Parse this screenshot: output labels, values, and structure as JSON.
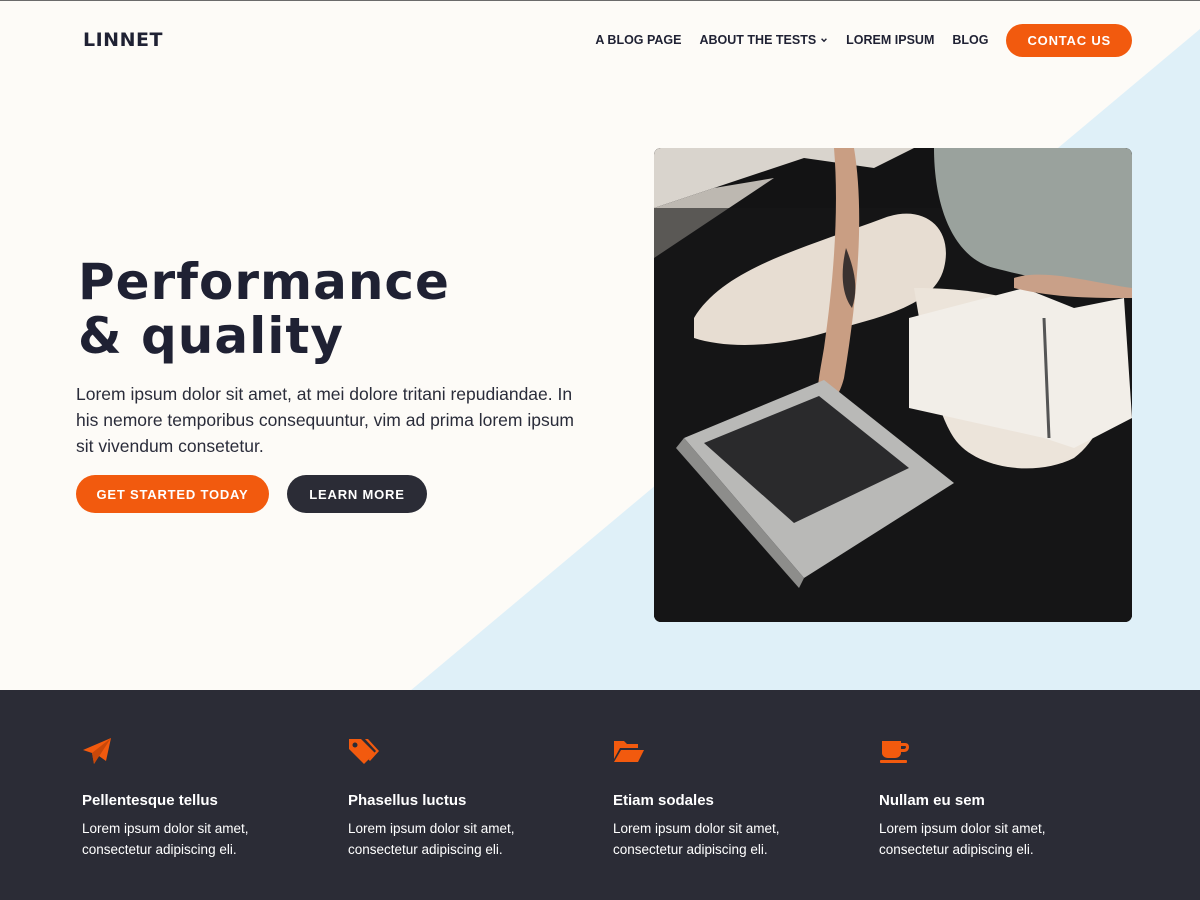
{
  "colors": {
    "accent": "#f25a0e",
    "dark": "#2b2c36",
    "navy_text": "#1f2133",
    "light_bg": "#fdfbf7",
    "light_blue": "#dff0f8"
  },
  "header": {
    "logo": "LINNET",
    "nav": [
      {
        "label": "A BLOG PAGE"
      },
      {
        "label": "ABOUT THE TESTS",
        "has_dropdown": true,
        "icon": "chevron-down-icon"
      },
      {
        "label": "LOREM IPSUM"
      },
      {
        "label": "BLOG"
      }
    ],
    "cta_label": "CONTAC US"
  },
  "hero": {
    "title_line1": "Performance",
    "title_line2": "& quality",
    "text": "Lorem ipsum dolor sit amet, at mei dolore tritani repudiandae. In his nemore temporibus consequuntur, vim ad prima lorem ipsum sit  vivendum consetetur.",
    "primary_button": "GET STARTED TODAY",
    "secondary_button": "LEARN MORE"
  },
  "features": [
    {
      "icon": "paper-plane-icon",
      "title": "Pellentesque tellus",
      "text": "Lorem ipsum dolor sit amet, consectetur adipiscing eli."
    },
    {
      "icon": "tags-icon",
      "title": "Phasellus luctus",
      "text": "Lorem ipsum dolor sit amet, consectetur adipiscing eli."
    },
    {
      "icon": "folder-open-icon",
      "title": "Etiam sodales",
      "text": "Lorem ipsum dolor sit amet, consectetur adipiscing eli."
    },
    {
      "icon": "coffee-cup-icon",
      "title": "Nullam eu sem",
      "text": "Lorem ipsum dolor sit amet, consectetur adipiscing eli."
    }
  ]
}
